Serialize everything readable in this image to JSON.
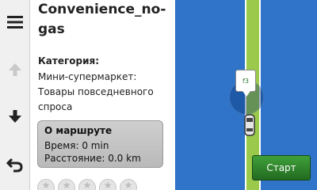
{
  "poi": {
    "title": "Convenience_no-gas",
    "category_label": "Категория:",
    "category_value": "Мини-супермаркет: Товары повседневного спроса"
  },
  "route": {
    "title": "О маршруте",
    "time": "Время: 0 min",
    "distance": "Расстояние: 0.0 km"
  },
  "map": {
    "marker_text": "f3",
    "start_label": "Старт"
  },
  "toolbar": {
    "icons": [
      "menu-icon",
      "arrow-up-icon",
      "arrow-down-icon",
      "back-icon"
    ]
  },
  "colors": {
    "water": "#2f74c8",
    "road": "#9bc94b",
    "start_button": "#2e8a2b"
  }
}
